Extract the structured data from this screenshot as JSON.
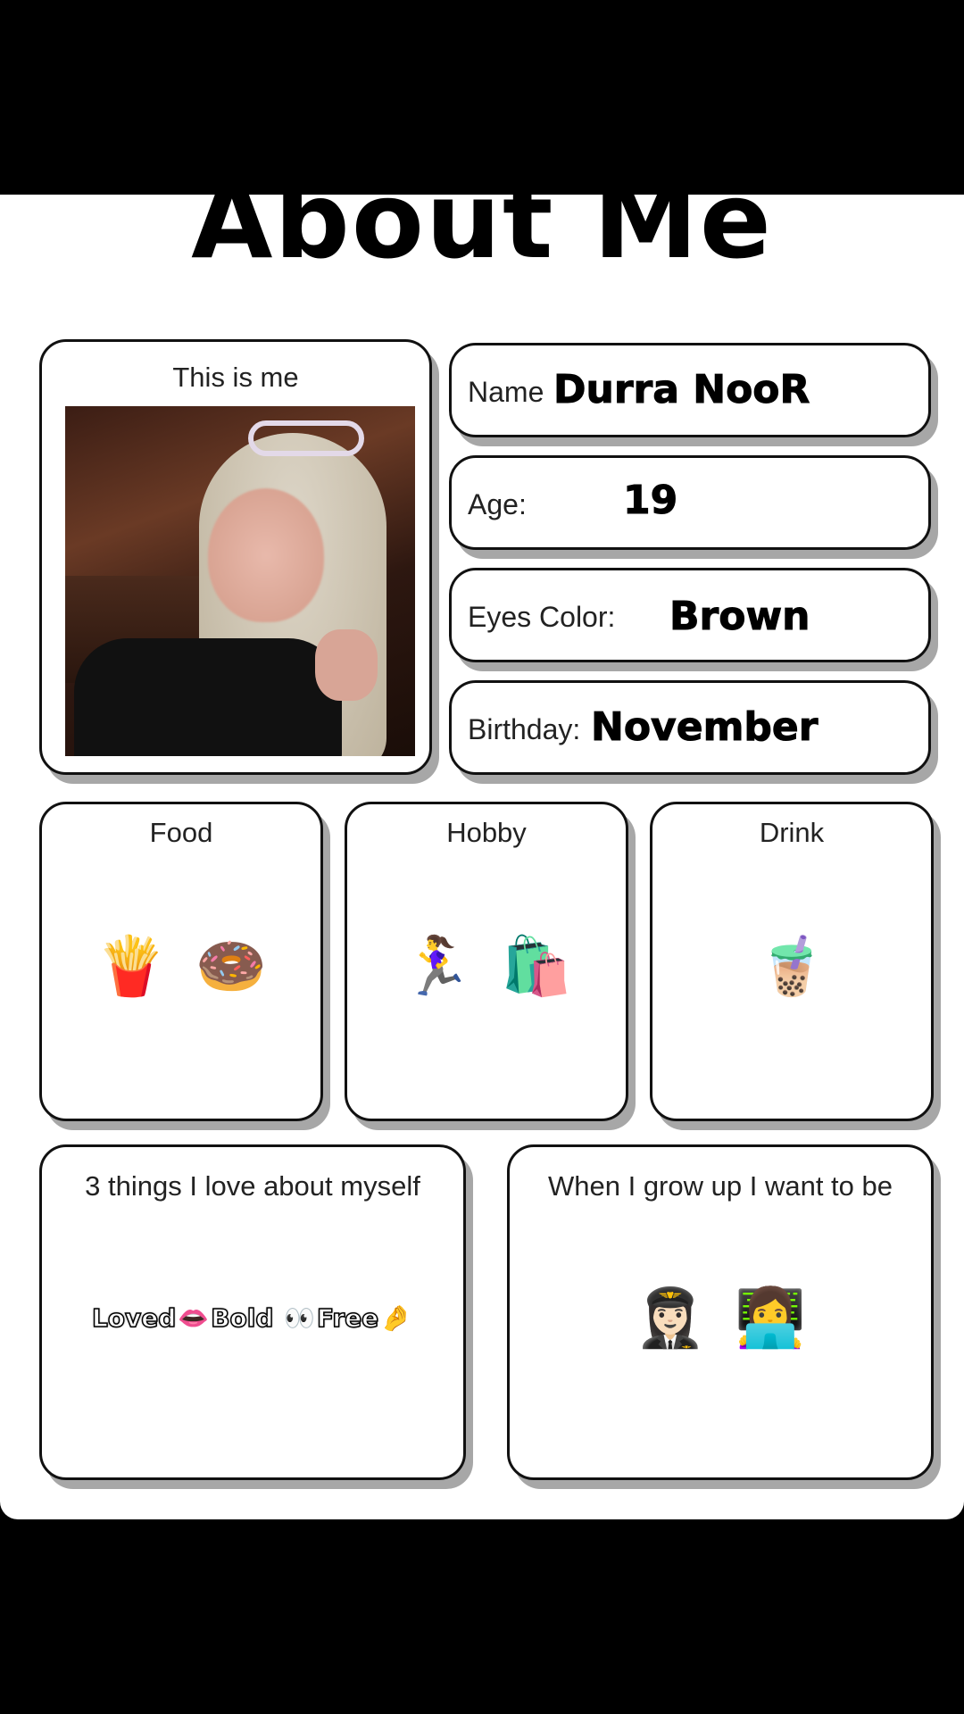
{
  "header": {
    "title": "About Me"
  },
  "photo_card": {
    "label": "This is me"
  },
  "info": {
    "name": {
      "label": "Name",
      "value": "Durra NooR"
    },
    "age": {
      "label": "Age:",
      "value": "19"
    },
    "eyes": {
      "label": "Eyes Color:",
      "value": "Brown"
    },
    "birthday": {
      "label": "Birthday:",
      "value": "November"
    }
  },
  "favorites": {
    "food": {
      "label": "Food",
      "emojis": [
        "🍟",
        "🍩"
      ]
    },
    "hobby": {
      "label": "Hobby",
      "emojis": [
        "🏃‍♀️",
        "🛍️"
      ]
    },
    "drink": {
      "label": "Drink",
      "emojis": [
        "🧋"
      ]
    }
  },
  "love_myself": {
    "label": "3 things I love about myself",
    "words": [
      "Loved",
      "Bold",
      "Free"
    ],
    "emojis": [
      "👄",
      "👀",
      "🤌"
    ]
  },
  "grow_up": {
    "label": "When I grow up I want to be",
    "emojis": [
      "👩🏻‍✈️",
      "👩‍💻"
    ]
  }
}
